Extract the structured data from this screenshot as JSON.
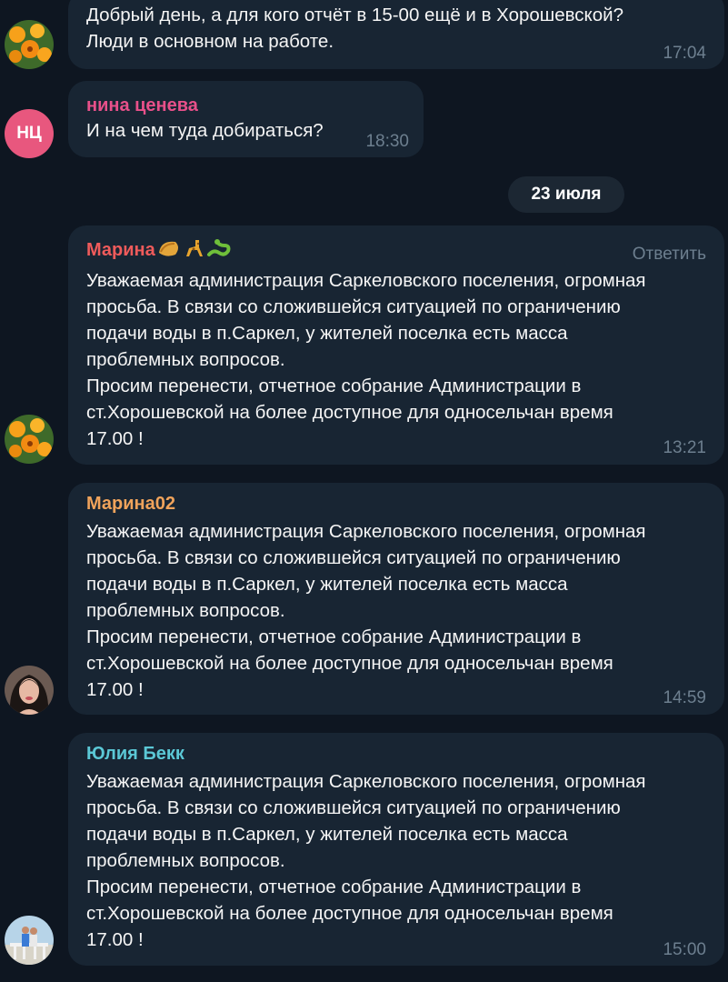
{
  "messages": {
    "m1": {
      "text": "Добрый день, а для кого отчёт в 15-00 ещё и в Хорошевской?\nЛюди в основном на работе.",
      "time": "17:04"
    },
    "m2": {
      "author": "нина ценева",
      "avatar_initials": "НЦ",
      "text": "И на чем туда добираться?",
      "time": "18:30"
    },
    "date_separator": "23 июля",
    "m3": {
      "author": "Марина",
      "reply_label": "Ответить",
      "text": "Уважаемая администрация Саркеловского поселения, огромная\nпросьба. В связи со сложившейся ситуацией по ограничению\nподачи воды в п.Саркел, у жителей поселка есть масса\nпроблемных вопросов.\nПросим перенести, отчетное собрание Администрации в\nст.Хорошевской на более доступное для односельчан  время\n17.00 !",
      "time": "13:21"
    },
    "m4": {
      "author": "Марина02",
      "text": "Уважаемая администрация Саркеловского поселения, огромная\nпросьба. В связи со сложившейся ситуацией по ограничению\nподачи воды в п.Саркел, у жителей поселка есть масса\nпроблемных вопросов.\nПросим перенести, отчетное собрание Администрации в\nст.Хорошевской на более доступное для односельчан  время\n17.00 !",
      "time": "14:59"
    },
    "m5": {
      "author": "Юлия Бекк",
      "text": "Уважаемая администрация Саркеловского поселения, огромная\nпросьба. В связи со сложившейся ситуацией по ограничению\nподачи воды в п.Саркел, у жителей поселка есть масса\nпроблемных вопросов.\nПросим перенести, отчетное собрание Администрации в\nст.Хорошевской на более доступное для односельчан  время\n17.00 !",
      "time": "15:00"
    }
  },
  "colors": {
    "background": "#0e1621",
    "bubble": "#182533",
    "author_nina": "#e8508a",
    "author_marina": "#ef5b5b",
    "author_marina02": "#f0a35b",
    "author_yulia": "#5bc8d6",
    "timestamp": "#6d7f8f"
  },
  "icons": {
    "marina_emoji": [
      "melon-emoji",
      "giraffe-emoji",
      "snake-emoji"
    ]
  }
}
